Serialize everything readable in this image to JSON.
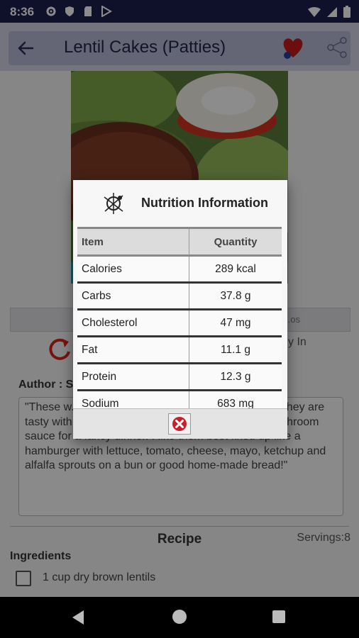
{
  "status": {
    "time": "8:36",
    "icons": [
      "gear-icon",
      "shield-icon",
      "sd-card-icon",
      "play-store-icon"
    ],
    "right_icons": [
      "wifi-icon",
      "signal-icon",
      "battery-icon"
    ]
  },
  "appbar": {
    "title": "Lentil Cakes (Patties)",
    "icons": [
      "back-arrow-icon",
      "heart-favorite-icon",
      "share-icon"
    ]
  },
  "background": {
    "tab_right_label": "...os",
    "made_in": "y In",
    "author_label": "Author : S",
    "description": "\"These w... transform... different... nuts for texture.  They are tasty with a tomato sauce topping or baked in a mushroom sauce for a fancy dinner. I like them best fixed up like a hamburger with lettuce, tomato, cheese, mayo, ketchup and alfalfa sprouts on a bun or good home-made bread!\"",
    "recipe_title": "Recipe",
    "servings": "Servings:8",
    "ingredients_label": "Ingredients",
    "ingredient_1": "1 cup dry brown lentils"
  },
  "dialog": {
    "title": "Nutrition Information",
    "logo_icon": "nutrition-logo-icon",
    "columns": [
      "Item",
      "Quantity"
    ],
    "rows": [
      {
        "item": "Calories",
        "quantity": "289 kcal"
      },
      {
        "item": "Carbs",
        "quantity": "37.8 g"
      },
      {
        "item": "Cholesterol",
        "quantity": "47 mg"
      },
      {
        "item": "Fat",
        "quantity": "11.1 g"
      },
      {
        "item": "Protein",
        "quantity": "12.3 g"
      },
      {
        "item": "Sodium",
        "quantity": "683 mg"
      }
    ],
    "close_icon": "close-x-icon"
  },
  "navbar": {
    "icons": [
      "nav-back-icon",
      "nav-home-icon",
      "nav-recents-icon"
    ]
  }
}
